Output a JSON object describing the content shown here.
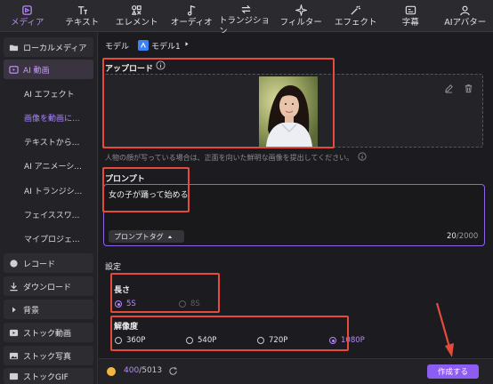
{
  "toolbar": {
    "tabs": [
      {
        "label": "メディア",
        "icon": "media-icon",
        "active": true
      },
      {
        "label": "テキスト",
        "icon": "text-icon"
      },
      {
        "label": "エレメント",
        "icon": "elements-icon"
      },
      {
        "label": "オーディオ",
        "icon": "music-note-icon"
      },
      {
        "label": "トランジション",
        "icon": "transition-icon"
      },
      {
        "label": "フィルター",
        "icon": "sparkle-icon"
      },
      {
        "label": "エフェクト",
        "icon": "magic-wand-icon"
      },
      {
        "label": "字幕",
        "icon": "caption-icon"
      },
      {
        "label": "AIアバター",
        "icon": "avatar-icon"
      }
    ]
  },
  "sidebar": {
    "local_media": "ローカルメディア",
    "ai_video": "AI 動画",
    "sub_items": [
      "AI エフェクト",
      "画像を動画に...",
      "テキストから...",
      "AI アニメーシ...",
      "AI トランジシ...",
      "フェイススワ...",
      "マイプロジェ..."
    ],
    "recorder": "レコード",
    "download": "ダウンロード",
    "background": "背景",
    "stock_video": "ストック動画",
    "stock_photo": "ストック写真",
    "stock_gif": "ストックGIF"
  },
  "main": {
    "model_label": "モデル",
    "model_name": "モデル1",
    "upload_label": "アップロード",
    "upload_hint": "人物の顔が写っている場合は、正面を向いた鮮明な画像を提出してください。",
    "prompt_label": "プロンプト",
    "prompt_text": "女の子が踊って始める",
    "prompt_tag_button": "プロンプトタグ",
    "counter_current": "20",
    "counter_max": "/2000",
    "settings_label": "設定",
    "length_label": "長さ",
    "length_options": [
      {
        "label": "5S",
        "selected": true
      },
      {
        "label": "8S",
        "selected": false,
        "disabled": true
      }
    ],
    "resolution_label": "解像度",
    "resolution_options": [
      {
        "label": "360P",
        "selected": false
      },
      {
        "label": "540P",
        "selected": false
      },
      {
        "label": "720P",
        "selected": false
      },
      {
        "label": "1080P",
        "selected": true
      }
    ]
  },
  "bottom": {
    "credits_used": "400",
    "credits_total": "/5013",
    "create_button": "作成する"
  },
  "colors": {
    "accent": "#b987ff",
    "highlight_box": "#e54b3c",
    "create_button": "#8d5cf2",
    "annotation_arrow": "#e54b3c"
  }
}
